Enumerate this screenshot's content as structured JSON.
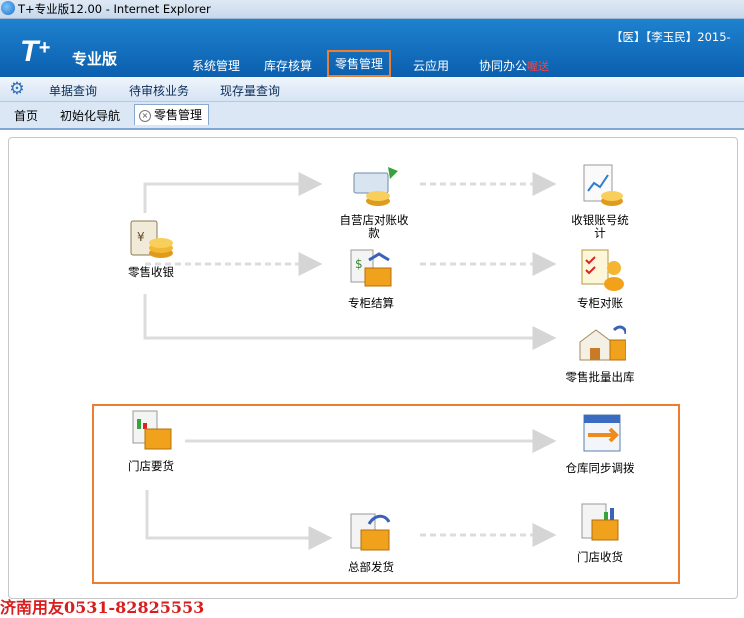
{
  "window": {
    "title": "T+专业版12.00 - Internet Explorer"
  },
  "header": {
    "logo_text": "T",
    "logo_sup": "+",
    "product": "专业版",
    "user": "【医】【李玉民】2015-",
    "nav": [
      {
        "label": "系统管理"
      },
      {
        "label": "库存核算"
      },
      {
        "label": "零售管理"
      },
      {
        "label": "云应用"
      },
      {
        "label": "协同办公",
        "badge": "喔送"
      }
    ]
  },
  "toolbar": {
    "items": [
      {
        "label": "单据查询"
      },
      {
        "label": "待审核业务"
      },
      {
        "label": "现存量查询"
      }
    ]
  },
  "tabs": [
    {
      "label": "首页"
    },
    {
      "label": "初始化导航"
    },
    {
      "label": "零售管理",
      "close": "×"
    }
  ],
  "flow": {
    "nodes": [
      {
        "id": "retail-cashier",
        "label": "零售收银",
        "icon": "cash-register-icon"
      },
      {
        "id": "self-store-reconcile",
        "label": "自营店对账收款",
        "icon": "coins-card-icon"
      },
      {
        "id": "cashier-account-stats",
        "label": "收银账号统计",
        "icon": "report-chart-icon"
      },
      {
        "id": "counter-settlement",
        "label": "专柜结算",
        "icon": "settlement-box-icon"
      },
      {
        "id": "counter-reconcile",
        "label": "专柜对账",
        "icon": "checklist-user-icon"
      },
      {
        "id": "retail-batch-out",
        "label": "零售批量出库",
        "icon": "warehouse-out-icon"
      },
      {
        "id": "store-requisition",
        "label": "门店要货",
        "icon": "store-order-icon"
      },
      {
        "id": "warehouse-sync-transfer",
        "label": "仓库同步调拨",
        "icon": "sync-transfer-icon"
      },
      {
        "id": "hq-shipping",
        "label": "总部发货",
        "icon": "hq-ship-icon"
      },
      {
        "id": "store-receiving",
        "label": "门店收货",
        "icon": "store-receive-icon"
      }
    ]
  },
  "footer": {
    "text": "济南用友0531-82825553"
  },
  "colors": {
    "header": "#0b5fae",
    "highlight": "#ed7d31",
    "footer": "#d81e1e"
  }
}
